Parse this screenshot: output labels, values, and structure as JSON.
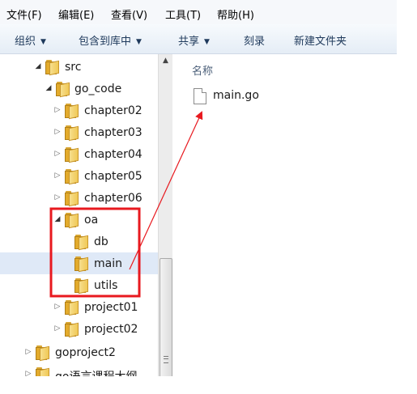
{
  "menubar": {
    "items": [
      "文件(F)",
      "编辑(E)",
      "查看(V)",
      "工具(T)",
      "帮助(H)"
    ]
  },
  "toolbar": {
    "organize": "组织",
    "include_in_library": "包含到库中",
    "share": "共享",
    "burn": "刻录",
    "new_folder": "新建文件夹"
  },
  "tree": {
    "items": [
      {
        "label": "src",
        "expanded": true
      },
      {
        "label": "go_code",
        "expanded": true
      },
      {
        "label": "chapter02",
        "expanded": false
      },
      {
        "label": "chapter03",
        "expanded": false
      },
      {
        "label": "chapter04",
        "expanded": false
      },
      {
        "label": "chapter05",
        "expanded": false
      },
      {
        "label": "chapter06",
        "expanded": false
      },
      {
        "label": "oa",
        "expanded": true
      },
      {
        "label": "db"
      },
      {
        "label": "main",
        "selected": true
      },
      {
        "label": "utils"
      },
      {
        "label": "project01",
        "expanded": false
      },
      {
        "label": "project02",
        "expanded": false
      },
      {
        "label": "goproject2",
        "expanded": false
      },
      {
        "label": "go语言课程大纲",
        "expanded": false
      }
    ]
  },
  "content": {
    "column_header": "名称",
    "files": [
      {
        "name": "main.go",
        "icon": "text-file-icon"
      }
    ]
  },
  "annotation": {
    "color": "#e8191f"
  },
  "colors": {
    "selected_row": "#dfe9f7",
    "toolbar_text": "#1e395b",
    "folder": "#e3ab2c"
  }
}
